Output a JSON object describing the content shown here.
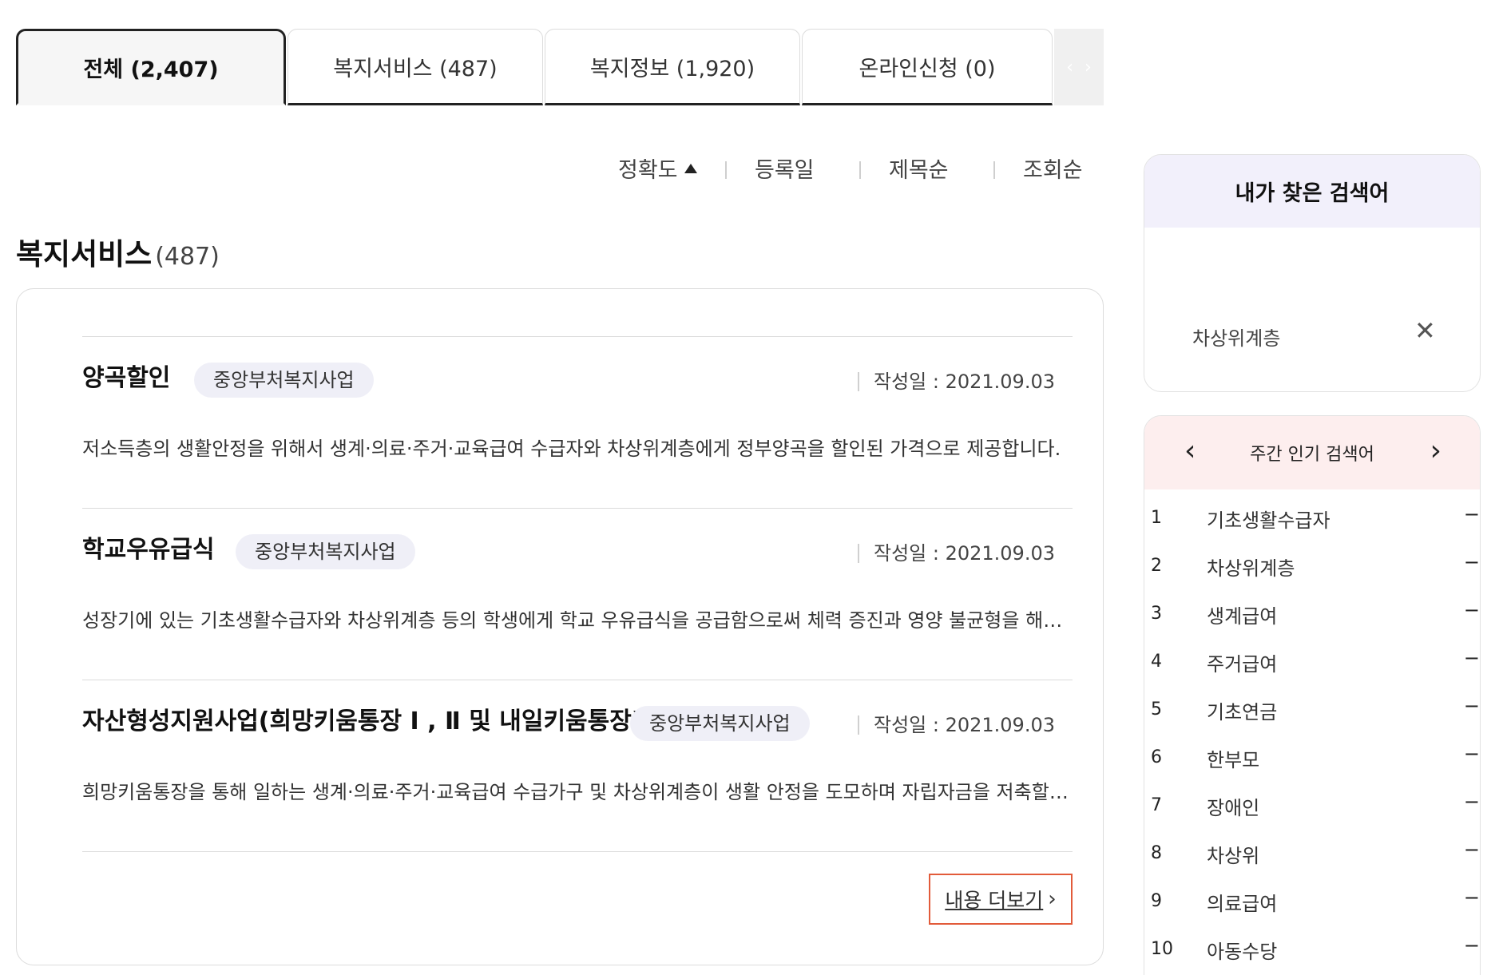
{
  "tabs": [
    {
      "label": "전체  (2,407)",
      "active": true
    },
    {
      "label": "복지서비스 (487)",
      "active": false
    },
    {
      "label": "복지정보 (1,920)",
      "active": false
    },
    {
      "label": "온라인신청 (0)",
      "active": false
    }
  ],
  "tab_scroll": {
    "prev": "‹",
    "next": "›"
  },
  "sort": {
    "items": [
      "정확도",
      "등록일",
      "제목순",
      "조회순"
    ],
    "active": "정확도"
  },
  "section": {
    "title": "복지서비스",
    "count": "(487)"
  },
  "results": [
    {
      "title": "양곡할인",
      "tag": "중앙부처복지사업",
      "date": "작성일 : 2021.09.03",
      "desc": "저소득층의 생활안정을 위해서 생계·의료·주거·교육급여 수급자와 차상위계층에게 정부양곡을 할인된 가격으로 제공합니다."
    },
    {
      "title": "학교우유급식",
      "tag": "중앙부처복지사업",
      "date": "작성일 : 2021.09.03",
      "desc": "성장기에 있는 기초생활수급자와 차상위계층 등의 학생에게 학교 우유급식을 공급함으로써 체력 증진과 영양 불균형을 해소하고, 건강한 성장을 도모합니다."
    },
    {
      "title": "자산형성지원사업(희망키움통장 Ⅰ , Ⅱ 및 내일키움통장)",
      "tag": "중앙부처복지사업",
      "date": "작성일 : 2021.09.03",
      "desc": "희망키움통장을 통해 일하는 생계·의료·주거·교육급여 수급가구 및 차상위계층이 생활 안정을 도모하며 자립자금을 저축할 수 있도록 지원합니다."
    }
  ],
  "more_button": {
    "label": "내용 더보기",
    "chevron": "›"
  },
  "my_searches": {
    "title": "내가 찾은 검색어",
    "items": [
      "차상위계층"
    ],
    "close_glyph": "✕"
  },
  "popular": {
    "title": "주간 인기 검색어",
    "prev": "‹",
    "next": "›",
    "items": [
      {
        "rank": "1",
        "keyword": "기초생활수급자",
        "change": "−"
      },
      {
        "rank": "2",
        "keyword": "차상위계층",
        "change": "−"
      },
      {
        "rank": "3",
        "keyword": "생계급여",
        "change": "−"
      },
      {
        "rank": "4",
        "keyword": "주거급여",
        "change": "−"
      },
      {
        "rank": "5",
        "keyword": "기초연금",
        "change": "−"
      },
      {
        "rank": "6",
        "keyword": "한부모",
        "change": "−"
      },
      {
        "rank": "7",
        "keyword": "장애인",
        "change": "−"
      },
      {
        "rank": "8",
        "keyword": "차상위",
        "change": "−"
      },
      {
        "rank": "9",
        "keyword": "의료급여",
        "change": "−"
      },
      {
        "rank": "10",
        "keyword": "아동수당",
        "change": "−"
      }
    ]
  },
  "colors": {
    "accent_border": "#e25b3a",
    "my_header_bg": "#f2f0fb",
    "popular_header_bg": "#fdeeee",
    "tag_bg": "#efeff7"
  }
}
